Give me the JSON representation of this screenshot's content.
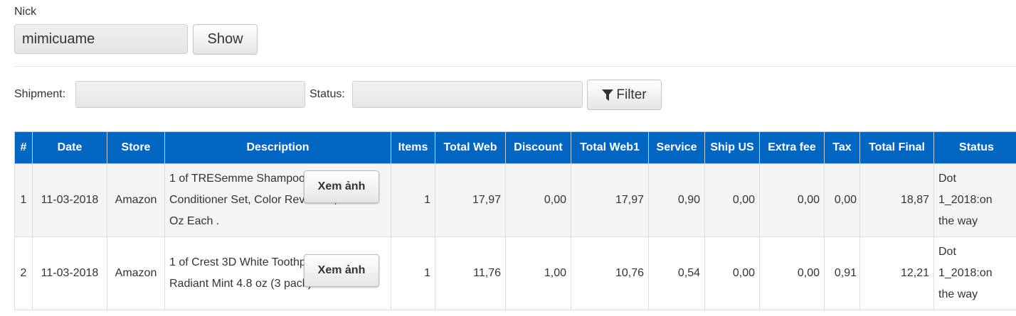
{
  "nick": {
    "label": "Nick",
    "value": "mimicuame",
    "show_label": "Show"
  },
  "filters": {
    "shipment_label": "Shipment:",
    "shipment_value": "",
    "status_label": "Status:",
    "status_value": "",
    "filter_label": "Filter",
    "filter_icon": "funnel-icon"
  },
  "table": {
    "headers": [
      "#",
      "Date",
      "Store",
      "Description",
      "Items",
      "Total Web",
      "Discount",
      "Total Web1",
      "Service",
      "Ship US",
      "Extra fee",
      "Tax",
      "Total Final",
      "Status"
    ],
    "view_image_label": "Xem ảnh",
    "rows": [
      {
        "num": "1",
        "date": "11-03-2018",
        "store": "Amazon",
        "description": "1 of TRESemme Shampoo and\nConditioner Set, Color Revitalize,\nOz Each .",
        "items": "1",
        "total_web": "17,97",
        "discount": "0,00",
        "total_web1": "17,97",
        "service": "0,90",
        "ship_us": "0,00",
        "extra_fee": "0,00",
        "tax": "0,00",
        "total_final": "18,87",
        "status": "Dot\n1_2018:on\nthe way"
      },
      {
        "num": "2",
        "date": "11-03-2018",
        "store": "Amazon",
        "description": "1 of Crest 3D White Toothpaste\nRadiant Mint 4.8 oz (3 pack)",
        "items": "1",
        "total_web": "11,76",
        "discount": "1,00",
        "total_web1": "10,76",
        "service": "0,54",
        "ship_us": "0,00",
        "extra_fee": "0,00",
        "tax": "0,91",
        "total_final": "12,21",
        "status": "Dot\n1_2018:on\nthe way"
      }
    ]
  }
}
